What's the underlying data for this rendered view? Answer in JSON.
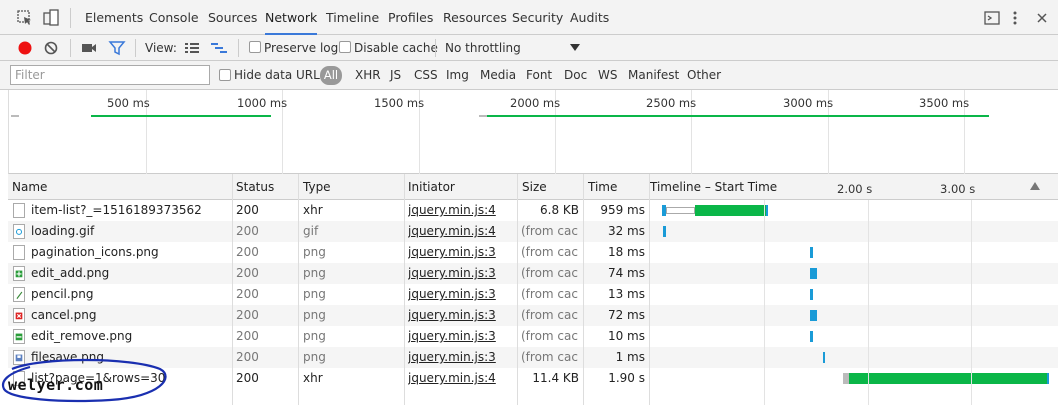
{
  "tabs": [
    {
      "label": "Elements"
    },
    {
      "label": "Console"
    },
    {
      "label": "Sources"
    },
    {
      "label": "Network",
      "active": true
    },
    {
      "label": "Timeline"
    },
    {
      "label": "Profiles"
    },
    {
      "label": "Resources"
    },
    {
      "label": "Security"
    },
    {
      "label": "Audits"
    }
  ],
  "toolbar": {
    "view_label": "View:",
    "preserve_log": "Preserve log",
    "disable_cache": "Disable cache",
    "throttling": "No throttling"
  },
  "filterbar": {
    "placeholder": "Filter",
    "hide_data_urls": "Hide data URLs",
    "types": [
      "All",
      "XHR",
      "JS",
      "CSS",
      "Img",
      "Media",
      "Font",
      "Doc",
      "WS",
      "Manifest",
      "Other"
    ]
  },
  "overview": {
    "labels": [
      "500 ms",
      "1000 ms",
      "1500 ms",
      "2000 ms",
      "2500 ms",
      "3000 ms",
      "3500 ms"
    ]
  },
  "table": {
    "headers": {
      "name": "Name",
      "status": "Status",
      "type": "Type",
      "initiator": "Initiator",
      "size": "Size",
      "time": "Time",
      "timeline": "Timeline – Start Time"
    },
    "timeline_labels": [
      "2.00 s",
      "3.00 s"
    ],
    "rows": [
      {
        "name": "item-list?_=1516189373562",
        "status": "200",
        "type": "xhr",
        "initiator": "jquery.min.js:4",
        "size": "6.8 KB",
        "time": "959 ms",
        "cached": false,
        "icon": "file-icon"
      },
      {
        "name": "loading.gif",
        "status": "200",
        "type": "gif",
        "initiator": "jquery.min.js:4",
        "size": "(from cac...",
        "time": "32 ms",
        "cached": true,
        "icon": "gif-icon"
      },
      {
        "name": "pagination_icons.png",
        "status": "200",
        "type": "png",
        "initiator": "jquery.min.js:3",
        "size": "(from cac...",
        "time": "18 ms",
        "cached": true,
        "icon": "file-icon"
      },
      {
        "name": "edit_add.png",
        "status": "200",
        "type": "png",
        "initiator": "jquery.min.js:3",
        "size": "(from cac...",
        "time": "74 ms",
        "cached": true,
        "icon": "add-icon"
      },
      {
        "name": "pencil.png",
        "status": "200",
        "type": "png",
        "initiator": "jquery.min.js:3",
        "size": "(from cac...",
        "time": "13 ms",
        "cached": true,
        "icon": "pencil-icon"
      },
      {
        "name": "cancel.png",
        "status": "200",
        "type": "png",
        "initiator": "jquery.min.js:3",
        "size": "(from cac...",
        "time": "72 ms",
        "cached": true,
        "icon": "cancel-icon"
      },
      {
        "name": "edit_remove.png",
        "status": "200",
        "type": "png",
        "initiator": "jquery.min.js:3",
        "size": "(from cac...",
        "time": "10 ms",
        "cached": true,
        "icon": "remove-icon"
      },
      {
        "name": "filesave.png",
        "status": "200",
        "type": "png",
        "initiator": "jquery.min.js:3",
        "size": "(from cac...",
        "time": "1 ms",
        "cached": true,
        "icon": "save-icon"
      },
      {
        "name": "list?page=1&rows=30",
        "status": "200",
        "type": "xhr",
        "initiator": "jquery.min.js:4",
        "size": "11.4 KB",
        "time": "1.90 s",
        "cached": false,
        "icon": "file-icon"
      }
    ]
  },
  "watermark": "welyer.com",
  "colors": {
    "accent": "#3a79d9",
    "waterfall_green": "#0ab648",
    "waterfall_blue": "#1a9bd7",
    "record_red": "#e11"
  }
}
